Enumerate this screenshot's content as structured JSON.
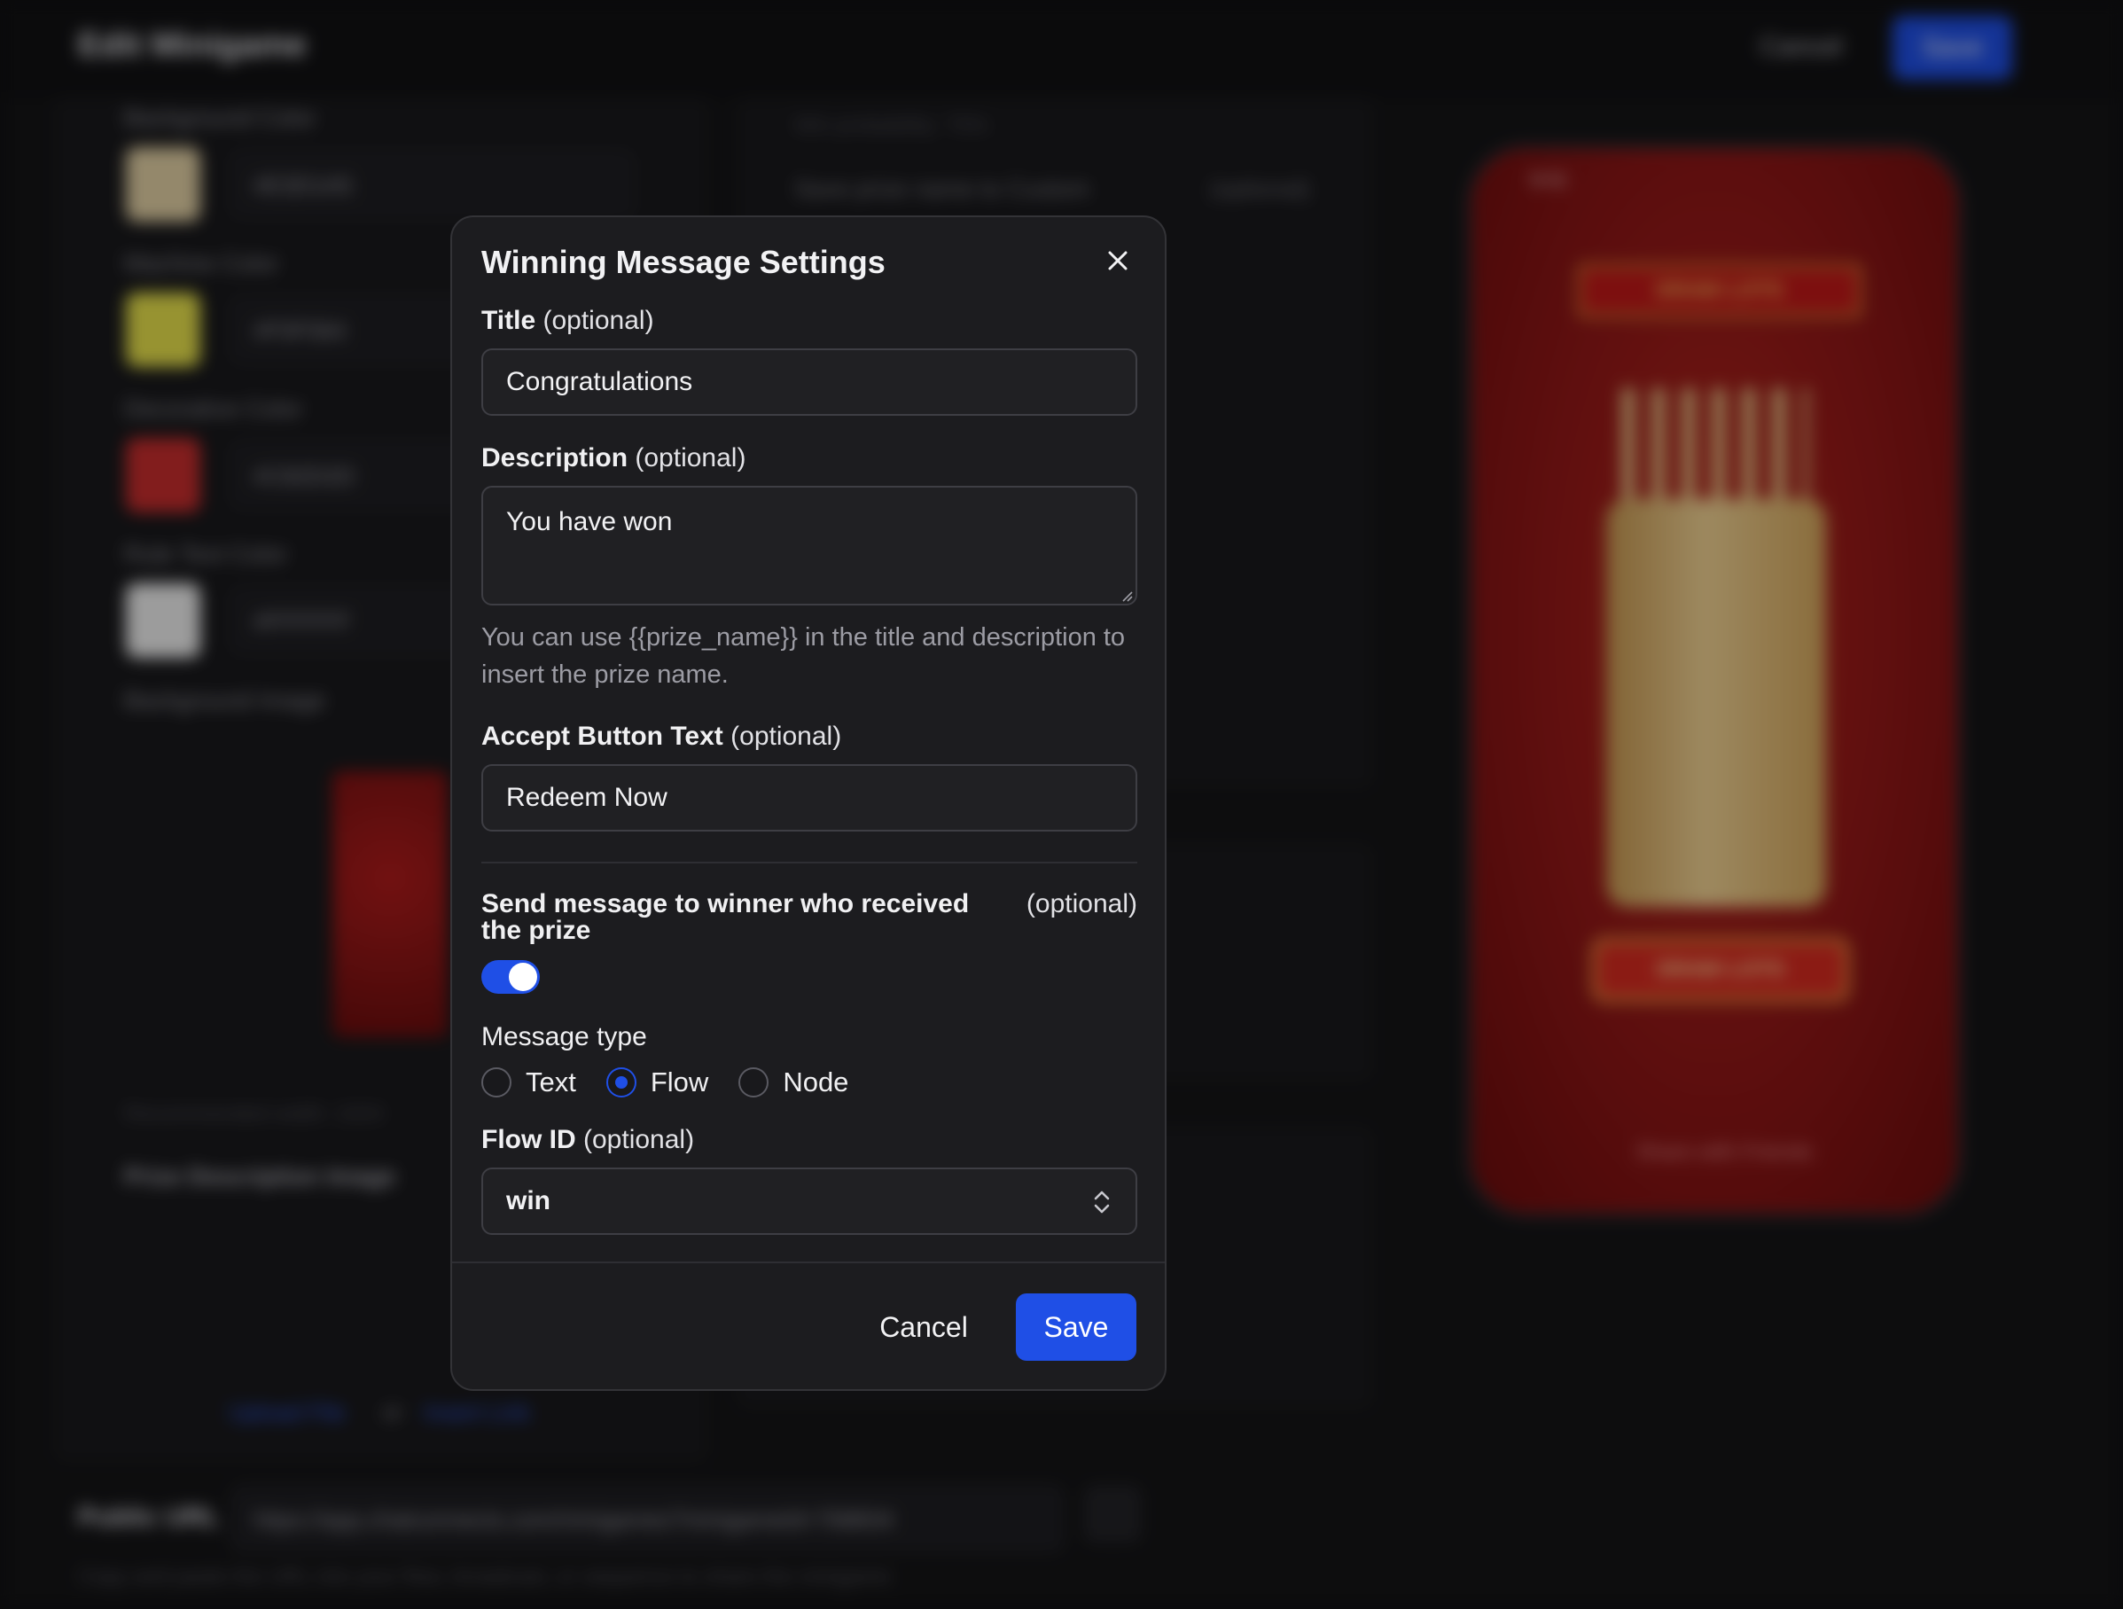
{
  "background": {
    "page_title": "Edit Minigame",
    "header_cancel": "Cancel",
    "header_save": "Save",
    "background_color_label": "Background Color",
    "background_color_value": "#E3D1A5",
    "machine_color_label": "Machine Color",
    "machine_color_value": "#F0F064",
    "decorative_color_label": "Decorative Color",
    "decorative_color_value": "#C82D2D",
    "rule_text_color_label": "Rule Text Color",
    "rule_text_color_value": "#FFFFFF",
    "background_image_label": "Background Image",
    "recommended_width": "Recommended width: 1024",
    "prize_description_image": "Prize Description Image",
    "upload_file": "Upload File",
    "or": "or",
    "insert_link": "Insert Link",
    "win_probability": "Win probability: 75%",
    "save_prize_name": "Save prize name to Custom",
    "optional": "(optional)",
    "phone_banner": "DRAW LOTS",
    "phone_button": "DRAW LOTS",
    "phone_share": "Share with Friends",
    "phone_time": "9:41",
    "public_url_label": "Public URL",
    "public_url_value": "https://app.chatconnects.com/minigames?minigameId=768834",
    "public_url_hint": "Copy and paste the URL into your flow, broadcast, or sequence to share the minigame"
  },
  "modal": {
    "title": "Winning Message Settings",
    "title_field": {
      "label": "Title",
      "optional": "(optional)",
      "value": "Congratulations"
    },
    "description_field": {
      "label": "Description",
      "optional": "(optional)",
      "value": "You have won"
    },
    "help_text": "You can use {{prize_name}} in the title and description to insert the prize name.",
    "accept_field": {
      "label": "Accept Button Text",
      "optional": "(optional)",
      "value": "Redeem Now"
    },
    "send_message": {
      "label": "Send message to winner who received the prize",
      "optional": "(optional)",
      "enabled": true
    },
    "message_type": {
      "label": "Message type",
      "options": [
        "Text",
        "Flow",
        "Node"
      ],
      "selected": "Flow"
    },
    "flow_id": {
      "label": "Flow ID",
      "optional": "(optional)",
      "value": "win"
    },
    "cancel_label": "Cancel",
    "save_label": "Save"
  },
  "colors": {
    "accent": "#1F4FE6",
    "modal_bg": "#1C1C1F",
    "border": "#3E3E44"
  }
}
